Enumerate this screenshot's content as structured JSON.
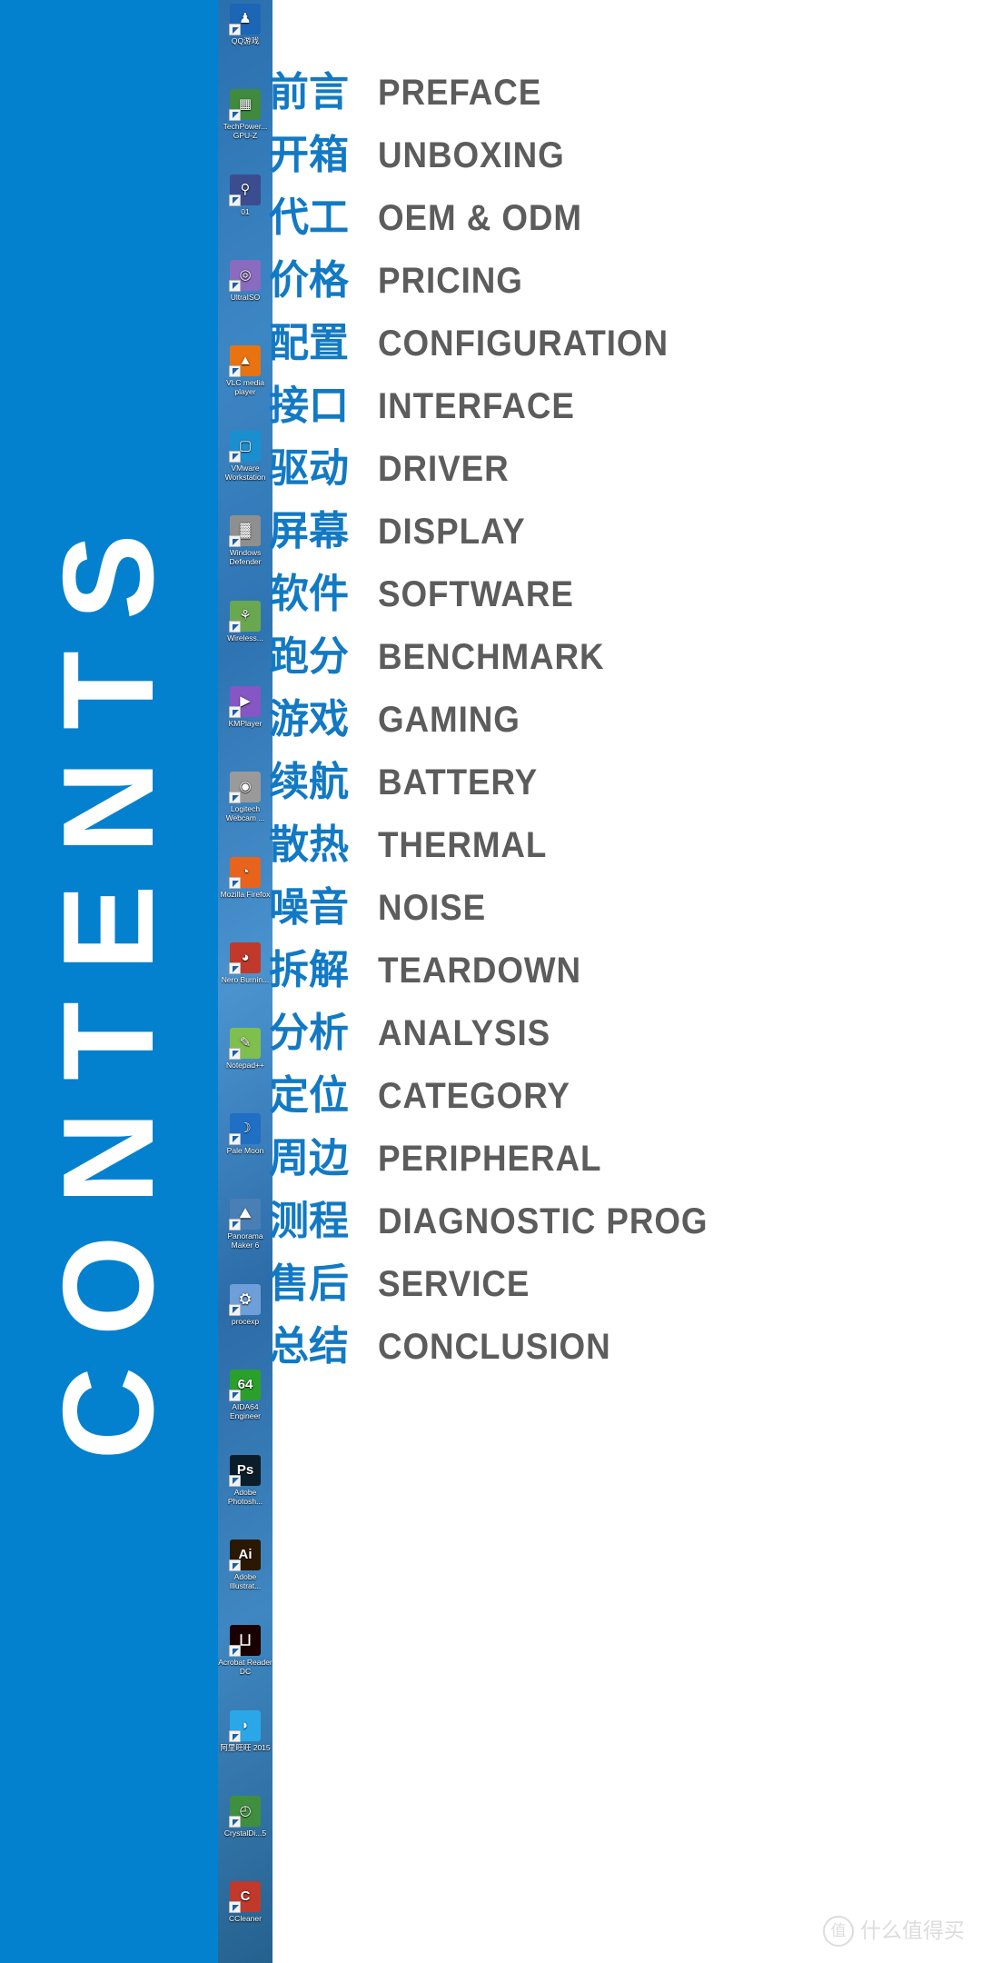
{
  "panel": {
    "title": "CONTENTS",
    "background_color": "#0481ce",
    "text_color": "#ffffff"
  },
  "colors": {
    "panel_blue": "#0481ce",
    "heading_blue": "#1279c4",
    "english_gray": "#5c5c5c",
    "watermark_gray": "#dcdcdc",
    "desktop_blue": "#3d86c4"
  },
  "desktop": {
    "icons": [
      {
        "label": "QQ游戏",
        "icon": "qq-penguin-icon",
        "color": "#1c66b5",
        "glyph": "♟"
      },
      {
        "label": "TechPower... GPU-Z",
        "icon": "gpuz-card-icon",
        "color": "#3f8a3c",
        "glyph": "▦"
      },
      {
        "label": "01",
        "icon": "magnifier-shield-icon",
        "color": "#3b4d8f",
        "glyph": "⚲"
      },
      {
        "label": "UltraISO",
        "icon": "disc-icon",
        "color": "#8a6bc0",
        "glyph": "◎"
      },
      {
        "label": "VLC media player",
        "icon": "vlc-cone-icon",
        "color": "#e8730f",
        "glyph": "▲"
      },
      {
        "label": "VMware Workstation",
        "icon": "vmware-icon",
        "color": "#1a8fd0",
        "glyph": "▢"
      },
      {
        "label": "Windows Defender",
        "icon": "defender-wall-icon",
        "color": "#8f8f8f",
        "glyph": "▓"
      },
      {
        "label": "Wireless...",
        "icon": "wireless-network-icon",
        "color": "#6aa84f",
        "glyph": "⚘"
      },
      {
        "label": "KMPlayer",
        "icon": "kmplayer-icon",
        "color": "#8656c4",
        "glyph": "▶"
      },
      {
        "label": "Logitech Webcam ...",
        "icon": "webcam-icon",
        "color": "#9a9a9a",
        "glyph": "◉"
      },
      {
        "label": "Mozilla Firefox",
        "icon": "firefox-icon",
        "color": "#e8631c",
        "glyph": "◔"
      },
      {
        "label": "Nero Burnin...",
        "icon": "nero-burning-icon",
        "color": "#c0392b",
        "glyph": "◕"
      },
      {
        "label": "Notepad++",
        "icon": "notepadpp-icon",
        "color": "#7fbf4d",
        "glyph": "✎"
      },
      {
        "label": "Pale Moon",
        "icon": "palemoon-icon",
        "color": "#1f6fc4",
        "glyph": "☽"
      },
      {
        "label": "Panorama Maker 6",
        "icon": "panorama-icon",
        "color": "#4a7fb5",
        "glyph": "⛰"
      },
      {
        "label": "procexp",
        "icon": "process-explorer-icon",
        "color": "#6f9fd8",
        "glyph": "⛭"
      },
      {
        "label": "AIDA64 Engineer",
        "icon": "aida64-icon",
        "color": "#2aa02a",
        "glyph": "64"
      },
      {
        "label": "Adobe Photosh...",
        "icon": "photoshop-icon",
        "color": "#0b1d2b",
        "glyph": "Ps"
      },
      {
        "label": "Adobe Illustrat...",
        "icon": "illustrator-icon",
        "color": "#2b1800",
        "glyph": "Ai"
      },
      {
        "label": "Acrobat Reader DC",
        "icon": "acrobat-reader-icon",
        "color": "#1a0000",
        "glyph": "⨆"
      },
      {
        "label": "阿里旺旺 2015",
        "icon": "aliwangwang-icon",
        "color": "#2aa7e8",
        "glyph": "◗"
      },
      {
        "label": "CrystalDi...5",
        "icon": "crystaldiskmark-icon",
        "color": "#3f8f3f",
        "glyph": "◴"
      },
      {
        "label": "CCleaner",
        "icon": "ccleaner-icon",
        "color": "#c0392b",
        "glyph": "C"
      }
    ]
  },
  "toc": {
    "rows": [
      {
        "cn": "前言",
        "en": "PREFACE"
      },
      {
        "cn": "开箱",
        "en": "UNBOXING"
      },
      {
        "cn": "代工",
        "en": "OEM & ODM"
      },
      {
        "cn": "价格",
        "en": "PRICING"
      },
      {
        "cn": "配置",
        "en": "CONFIGURATION"
      },
      {
        "cn": "接口",
        "en": "INTERFACE"
      },
      {
        "cn": "驱动",
        "en": "DRIVER"
      },
      {
        "cn": "屏幕",
        "en": "DISPLAY"
      },
      {
        "cn": "软件",
        "en": "SOFTWARE"
      },
      {
        "cn": "跑分",
        "en": "BENCHMARK"
      },
      {
        "cn": "游戏",
        "en": "GAMING"
      },
      {
        "cn": "续航",
        "en": "BATTERY"
      },
      {
        "cn": "散热",
        "en": "THERMAL"
      },
      {
        "cn": "噪音",
        "en": "NOISE"
      },
      {
        "cn": "拆解",
        "en": "TEARDOWN"
      },
      {
        "cn": "分析",
        "en": "ANALYSIS"
      },
      {
        "cn": "定位",
        "en": "CATEGORY"
      },
      {
        "cn": "周边",
        "en": "PERIPHERAL"
      },
      {
        "cn": "测程",
        "en": "DIAGNOSTIC PROG"
      },
      {
        "cn": "售后",
        "en": "SERVICE"
      },
      {
        "cn": "总结",
        "en": "CONCLUSION"
      }
    ]
  },
  "watermark": {
    "mark": "值",
    "text": "什么值得买"
  }
}
